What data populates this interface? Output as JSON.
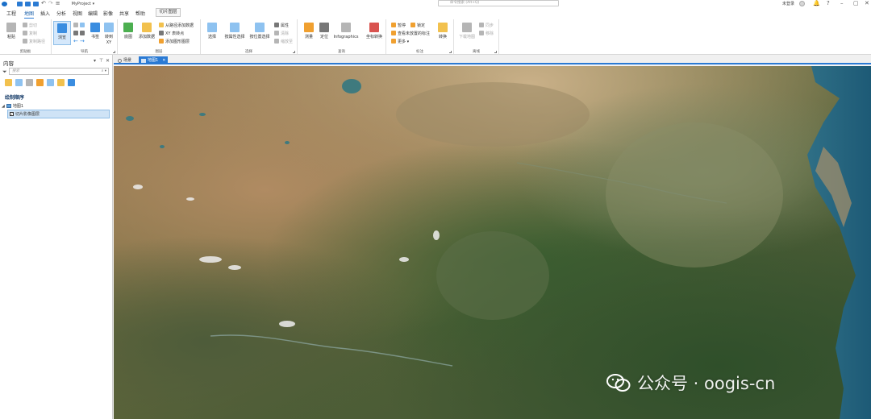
{
  "titlebar": {
    "project_name": "MyProject ▾",
    "search_placeholder": "命令搜索 (Alt+Q)",
    "signin_label": "未登录",
    "help_glyph": "?"
  },
  "menu": {
    "items": [
      "工程",
      "地图",
      "插入",
      "分析",
      "视图",
      "编辑",
      "影像",
      "共享",
      "帮助"
    ],
    "active_index": 1,
    "context_tab": "切片图层"
  },
  "ribbon": {
    "clipboard": {
      "label": "剪贴板",
      "paste": "粘贴",
      "cut": "剪切",
      "copy": "复制",
      "copy_path": "复制路径"
    },
    "navigate": {
      "label": "导航",
      "explore": "浏览",
      "bookmarks": "书签",
      "goto": "转到",
      "goto_sub": "XY"
    },
    "layer": {
      "label": "图层",
      "basemap": "底图",
      "add_data": "添加数据",
      "add_from_path": "从路径添加数据",
      "xy_table": "XY 表转点",
      "add_graphics": "添加图形图层"
    },
    "selection": {
      "label": "选择",
      "select": "选择",
      "by_attributes": "按属性选择",
      "by_location": "按位置选择",
      "attributes": "属性",
      "clear": "清除",
      "zoom_to": "缩放至"
    },
    "inquiry": {
      "label": "查询",
      "measure": "测量",
      "locate": "定位",
      "infographics": "Infographics",
      "coordinate_conversion": "坐标转换"
    },
    "labeling": {
      "label": "标注",
      "pause": "暂停",
      "lock": "锁定",
      "view_unplaced": "查看未放置的标注",
      "more": "更多 ▾",
      "convert": "转换"
    },
    "offline": {
      "label": "离线",
      "download_map": "下载地图",
      "sync": "同步",
      "remove": "移除"
    }
  },
  "contents_pane": {
    "title": "内容",
    "search_placeholder": "搜索",
    "drawing_order_label": "绘制顺序",
    "map_node": "地图1",
    "layer_name": "切片影像图层",
    "layer_checked": true
  },
  "view_tabs": [
    {
      "label": "场景",
      "active": false
    },
    {
      "label": "地图1",
      "active": true
    }
  ],
  "watermark": {
    "text": "公众号 · oogis-cn"
  },
  "colors": {
    "accent": "#2a7ad4",
    "selected_row": "#cfe3f6"
  }
}
